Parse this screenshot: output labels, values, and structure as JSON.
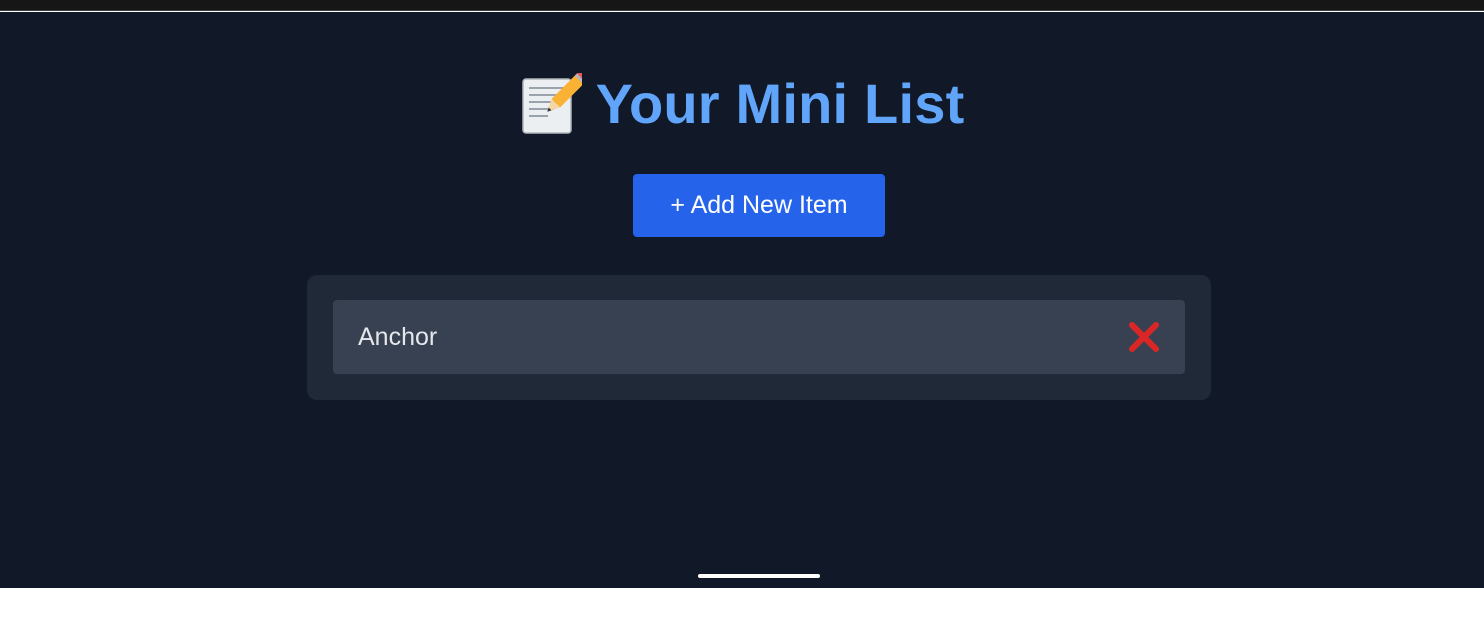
{
  "header": {
    "icon": "memo-pencil-icon",
    "title": "Your Mini List"
  },
  "toolbar": {
    "add_label": "+ Add New Item"
  },
  "list": {
    "items": [
      {
        "label": "Anchor",
        "delete_icon": "cross-mark-icon"
      }
    ]
  },
  "colors": {
    "background": "#111827",
    "panel": "#1f2937",
    "item": "#374151",
    "accent": "#60a5fa",
    "button": "#2563eb",
    "delete": "#dc2626"
  }
}
